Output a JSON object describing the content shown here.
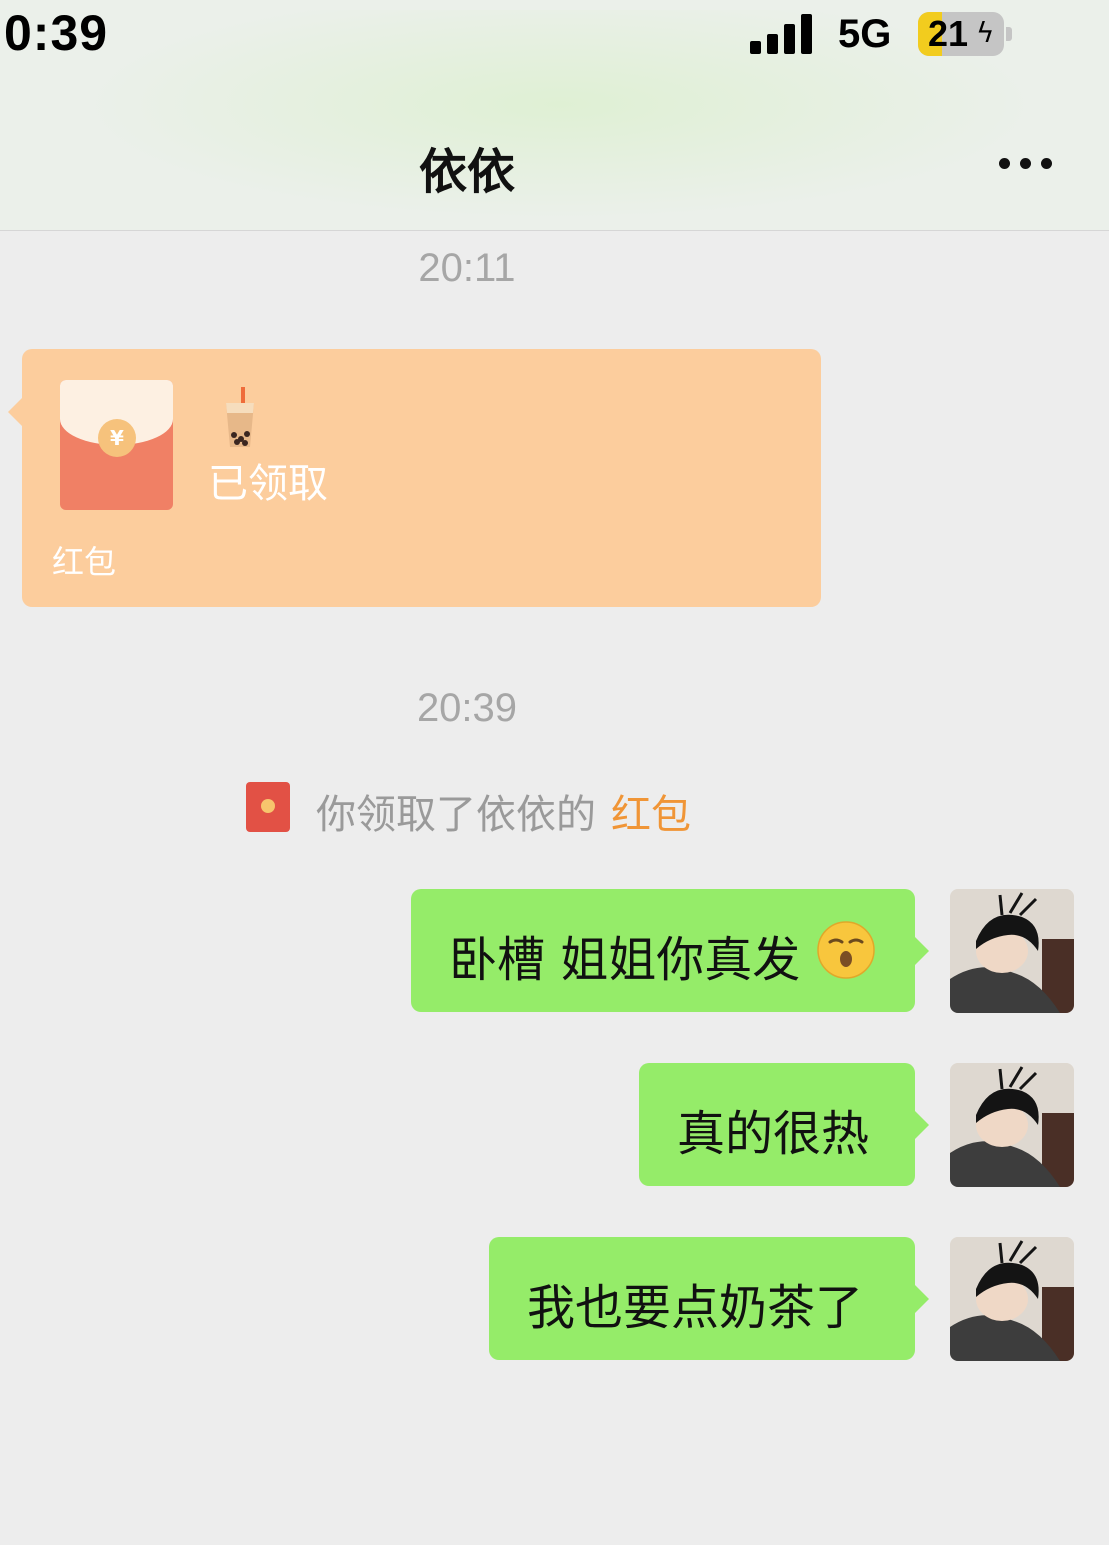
{
  "status_bar": {
    "time": "0:39",
    "network": "5G",
    "battery_level": "21",
    "battery_fraction": 0.21,
    "signal_bars": 4
  },
  "header": {
    "title": "依依",
    "more_icon": "ellipsis-icon"
  },
  "messages": {
    "time_1": "20:11",
    "red_packet": {
      "status": "已领取",
      "label": "红包",
      "decor_icon": "bubble-tea-emoji",
      "bg_color": "#fccd9d"
    },
    "time_2": "20:39",
    "system_notice": {
      "text": "你领取了依依的",
      "link": "红包",
      "link_color": "#f09536"
    },
    "outgoing": [
      {
        "text": "卧槽 姐姐你真发",
        "emoji": "kissing-face-emoji"
      },
      {
        "text": "真的很热"
      },
      {
        "text": "我也要点奶茶了"
      }
    ]
  },
  "colors": {
    "outgoing_bubble": "#95ec69",
    "background": "#ededed"
  }
}
